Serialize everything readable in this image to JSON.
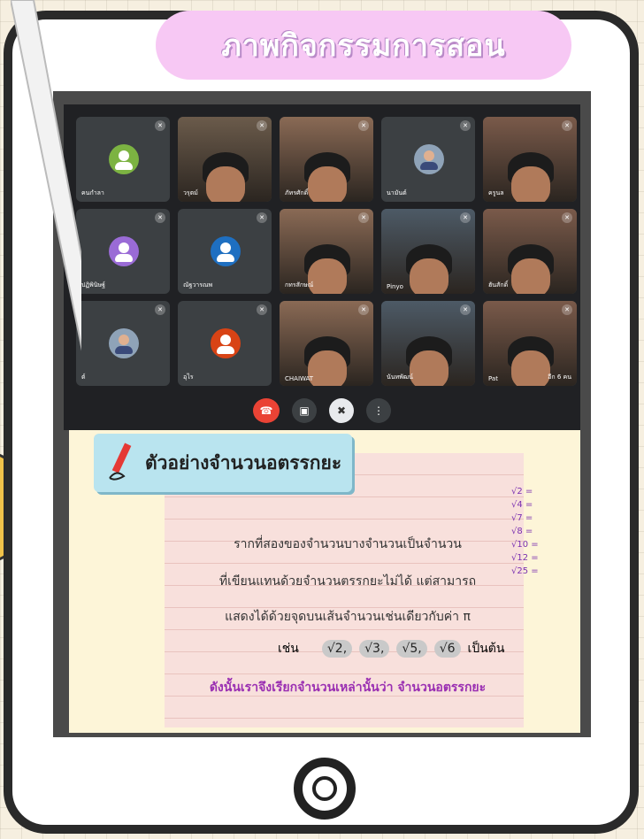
{
  "header": {
    "title": "ภาพกิจกรรมการสอน"
  },
  "meeting": {
    "participants": [
      {
        "name": "คนกำลา",
        "type": "avatar",
        "color": "#7cb342"
      },
      {
        "name": "วรุตม์",
        "type": "video"
      },
      {
        "name": "ภัทรศักดิ์",
        "type": "video"
      },
      {
        "name": "นามันต์",
        "type": "avatar-photo"
      },
      {
        "name": "ครูนล",
        "type": "video"
      },
      {
        "name": "ปฏิพินิษฐ์",
        "type": "avatar",
        "color": "#9a6bd6"
      },
      {
        "name": "ณัฐวารณพ",
        "type": "avatar",
        "color": "#1e6fc1"
      },
      {
        "name": "กทรสักษณ์",
        "type": "video"
      },
      {
        "name": "Pinyo",
        "type": "video"
      },
      {
        "name": "ฮันสักดิ์",
        "type": "video"
      },
      {
        "name": "ต์",
        "type": "avatar-photo"
      },
      {
        "name": "อุไร",
        "type": "avatar",
        "color": "#d84315"
      },
      {
        "name": "CHAIWAT",
        "type": "video"
      },
      {
        "name": "นันทพัฒน์",
        "type": "video"
      },
      {
        "name": "Pat",
        "type": "video"
      }
    ],
    "more_label": "อีก 6 คน",
    "controls": [
      "end-call",
      "camera",
      "mic",
      "more"
    ]
  },
  "slide": {
    "title": "ตัวอย่างจำนวนอตรรกยะ",
    "lines": [
      "รากที่สองของจำนวนบางจำนวนเป็นจำนวน",
      "ที่เขียนแทนด้วยจำนวนตรรกยะไม่ได้ แต่สามารถ",
      "แสดงได้ด้วยจุดบนเส้นจำนวนเช่นเดียวกับค่า π"
    ],
    "example_prefix": "เช่น",
    "roots": [
      "√2,",
      "√3,",
      "√5,",
      "√6"
    ],
    "example_suffix": "เป็นต้น",
    "conclusion": "ดังนั้นเราจึงเรียกจำนวนเหล่านั้นว่า จำนวนอตรรกยะ",
    "side_notes": [
      "√2 =",
      "√4 =",
      "√7 =",
      "√8 =",
      "√10 =",
      "√12 =",
      "√25 ="
    ]
  }
}
